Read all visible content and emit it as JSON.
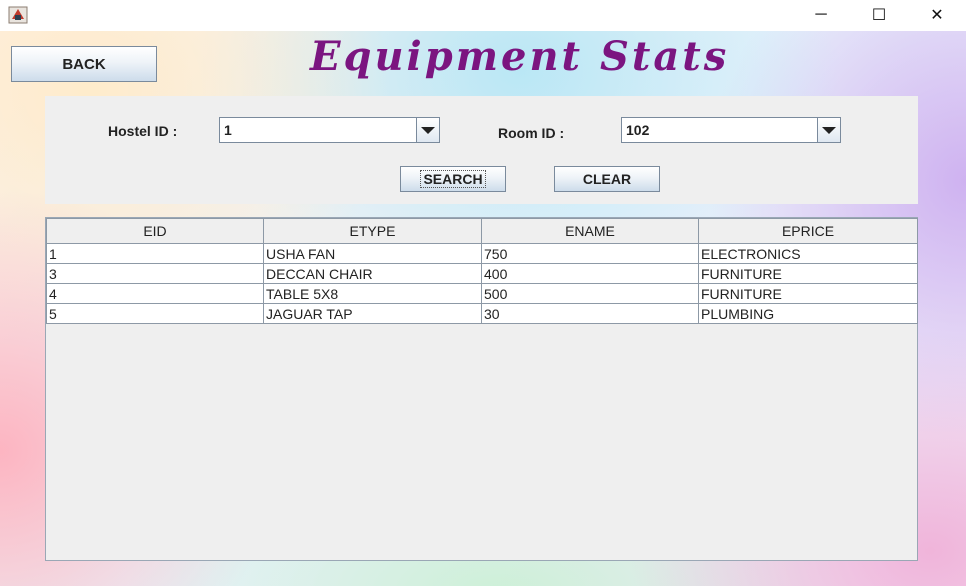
{
  "window": {
    "minimize_glyph": "─",
    "maximize_glyph": "☐",
    "close_glyph": "✕"
  },
  "header": {
    "back_label": "BACK",
    "title": "Equipment Stats"
  },
  "filters": {
    "hostel_label": "Hostel ID :",
    "hostel_value": "1",
    "room_label": "Room ID :",
    "room_value": "102",
    "search_label": "SEARCH",
    "clear_label": "CLEAR"
  },
  "table": {
    "columns": [
      "EID",
      "ETYPE",
      "ENAME",
      "EPRICE"
    ],
    "rows": [
      [
        "1",
        "USHA FAN",
        "750",
        "ELECTRONICS"
      ],
      [
        "3",
        "DECCAN CHAIR",
        "400",
        "FURNITURE"
      ],
      [
        "4",
        "TABLE 5X8",
        "500",
        "FURNITURE"
      ],
      [
        "5",
        "JAGUAR TAP",
        "30",
        "PLUMBING"
      ]
    ]
  },
  "colors": {
    "title": "#7b1580",
    "panel": "#efefef"
  }
}
